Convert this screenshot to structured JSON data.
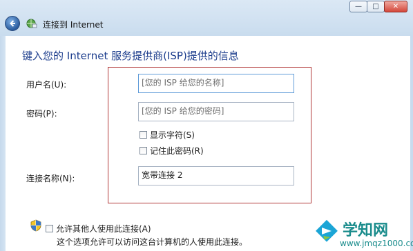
{
  "window": {
    "title": "连接到 Internet",
    "controls": {
      "minimize": "—",
      "maximize": "□",
      "close": "✕"
    }
  },
  "page": {
    "heading": "键入您的 Internet 服务提供商(ISP)提供的信息"
  },
  "form": {
    "username": {
      "label": "用户名(U):",
      "placeholder": "[您的 ISP 给您的名称]"
    },
    "password": {
      "label": "密码(P):",
      "placeholder": "[您的 ISP 给您的密码]"
    },
    "show_chars": {
      "label": "显示字符(S)",
      "checked": false
    },
    "remember_password": {
      "label": "记住此密码(R)",
      "checked": false
    },
    "connection_name": {
      "label": "连接名称(N):",
      "value": "宽带连接 2"
    }
  },
  "sharing": {
    "allow_others": {
      "label": "允许其他人使用此连接(A)",
      "checked": false
    },
    "description": "这个选项允许可以访问这台计算机的人使用此连接。"
  },
  "watermark": {
    "brand": "学知网",
    "url": "www.jmqz1000.com"
  },
  "colors": {
    "heading": "#1b3c8c",
    "highlight_box": "#b03636",
    "watermark": "#1a8c8c"
  }
}
